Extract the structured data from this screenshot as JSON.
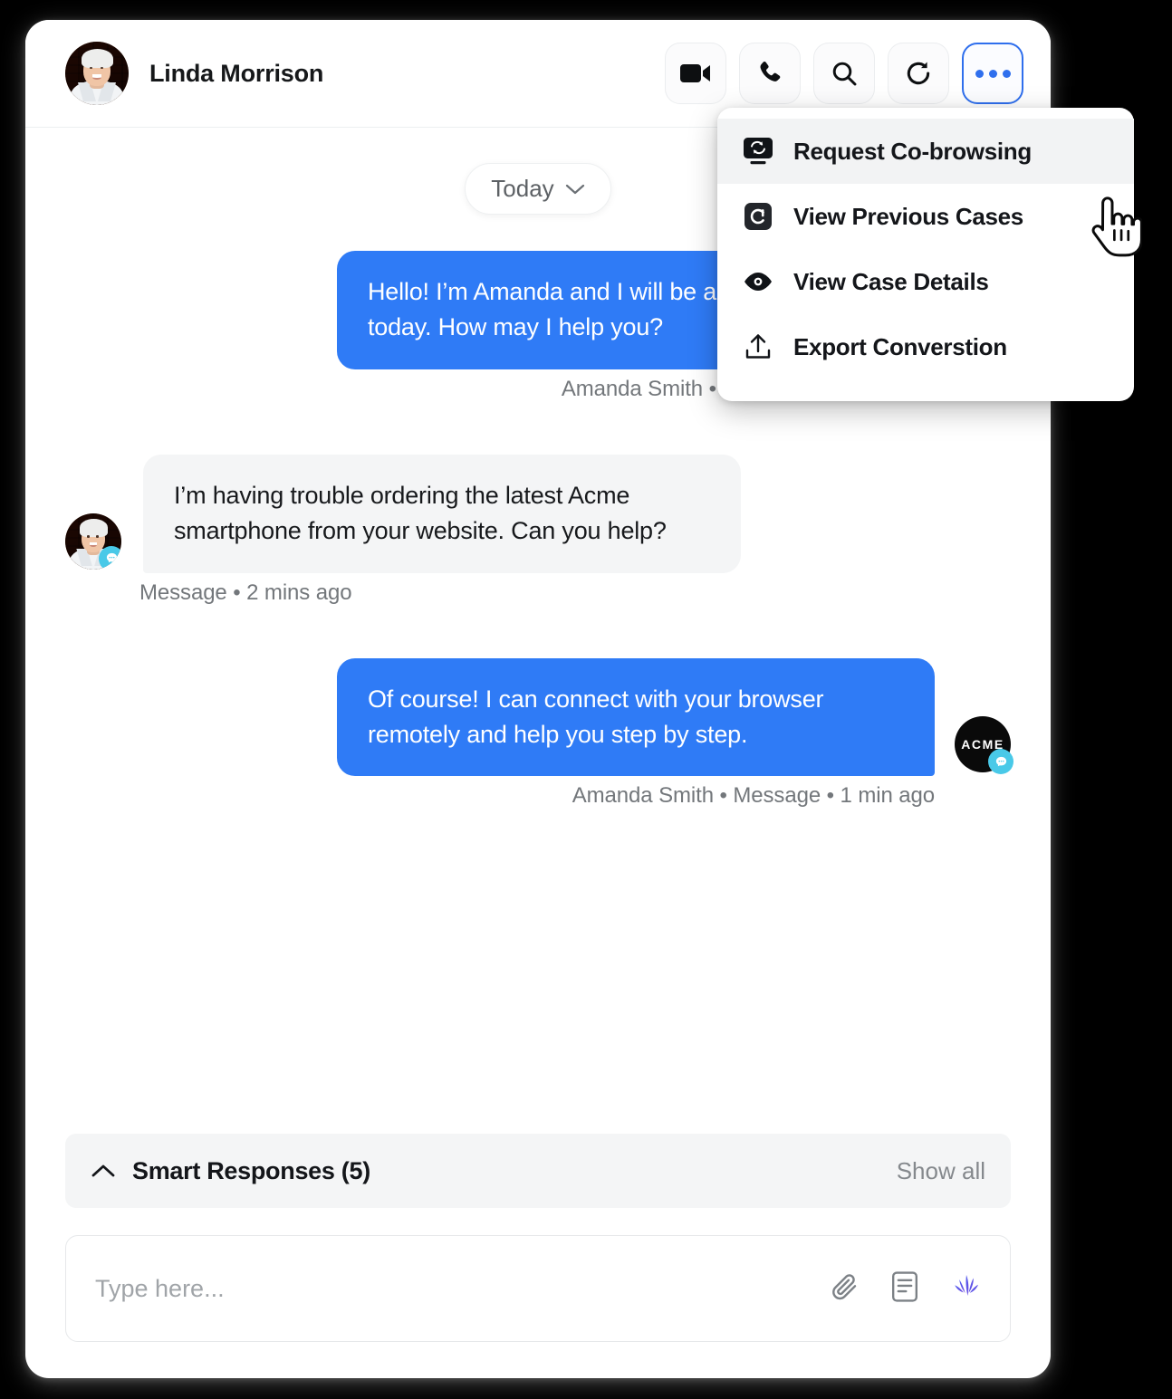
{
  "header": {
    "contact_name": "Linda Morrison",
    "avatar_alt": "Linda Morrison profile photo",
    "actions": [
      {
        "name": "video-call",
        "icon": "video-camera-icon",
        "active": false
      },
      {
        "name": "voice-call",
        "icon": "phone-icon",
        "active": false
      },
      {
        "name": "search",
        "icon": "search-icon",
        "active": false
      },
      {
        "name": "refresh",
        "icon": "refresh-icon",
        "active": false
      },
      {
        "name": "more-options",
        "icon": "more-horizontal-icon",
        "active": true
      }
    ]
  },
  "dropdown": {
    "items": [
      {
        "label": "Request Co-browsing",
        "icon": "co-browsing-icon",
        "highlighted": true
      },
      {
        "label": "View Previous Cases",
        "icon": "case-c-icon",
        "highlighted": false
      },
      {
        "label": "View Case Details",
        "icon": "eye-icon",
        "highlighted": false
      },
      {
        "label": "Export Converstion",
        "icon": "export-upload-icon",
        "highlighted": false
      }
    ]
  },
  "conversation": {
    "date_divider": "Today",
    "messages": [
      {
        "direction": "outgoing",
        "text": "Hello! I’m Amanda and I will be assisting you today. How may I help you?",
        "meta": "Amanda Smith • Message • 2 mins ago",
        "avatar": "acme-logo-avatar",
        "avatar_label": "ACME"
      },
      {
        "direction": "incoming",
        "text": "I’m having trouble ordering the latest Acme smartphone from your website. Can you help?",
        "meta": "Message • 2 mins ago",
        "avatar": "customer-photo-avatar",
        "avatar_label": ""
      },
      {
        "direction": "outgoing",
        "text": "Of course! I can connect with your browser remotely and help you step by step.",
        "meta": "Amanda Smith • Message • 1 min ago",
        "avatar": "acme-logo-avatar",
        "avatar_label": "ACME"
      }
    ]
  },
  "footer": {
    "smart_responses_label": "Smart Responses (5)",
    "show_all_label": "Show all",
    "composer_placeholder": "Type here...",
    "composer_value": "",
    "composer_icons": [
      "attachment-paperclip-icon",
      "knowledge-article-icon",
      "einstein-ai-icon"
    ]
  },
  "colors": {
    "accent_blue": "#2f7bf6",
    "outgoing_bubble": "#2f7bf6",
    "incoming_bubble": "#f4f5f6",
    "badge_cyan": "#49c9e8",
    "page_background": "#000000",
    "card_background": "#ffffff"
  }
}
